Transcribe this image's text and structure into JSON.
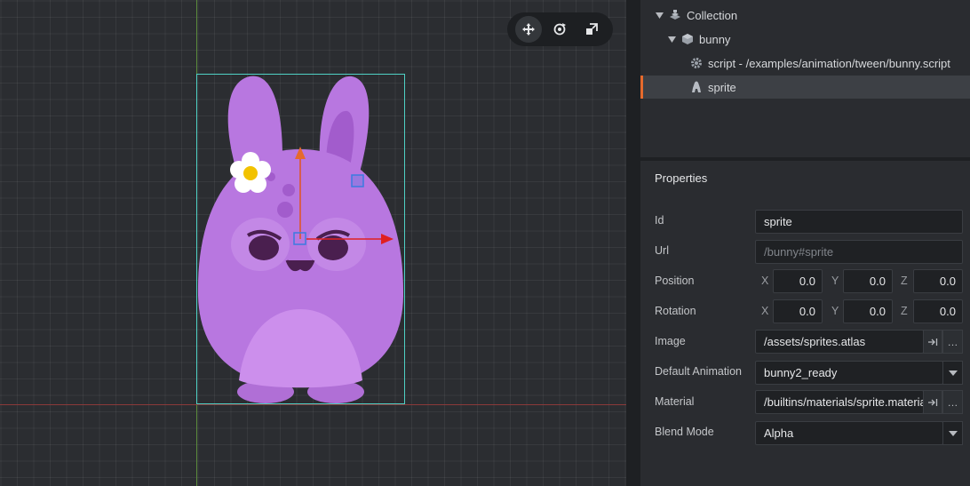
{
  "toolbar": {
    "move_icon": "move-icon",
    "rotate_icon": "rotate-icon",
    "scale_icon": "scale-icon"
  },
  "outline": {
    "items": [
      {
        "label": "Collection",
        "icon": "collection-icon"
      },
      {
        "label": "bunny",
        "icon": "gameobject-icon"
      },
      {
        "label": "script - /examples/animation/tween/bunny.script",
        "icon": "script-gear-icon"
      },
      {
        "label": "sprite",
        "icon": "sprite-icon"
      }
    ]
  },
  "properties": {
    "title": "Properties",
    "id": {
      "label": "Id",
      "value": "sprite"
    },
    "url": {
      "label": "Url",
      "placeholder": "/bunny#sprite"
    },
    "position": {
      "label": "Position",
      "x": "0.0",
      "y": "0.0",
      "z": "0.0"
    },
    "rotation": {
      "label": "Rotation",
      "x": "0.0",
      "y": "0.0",
      "z": "0.0"
    },
    "axis_x": "X",
    "axis_y": "Y",
    "axis_z": "Z",
    "image": {
      "label": "Image",
      "value": "/assets/sprites.atlas"
    },
    "default_animation": {
      "label": "Default Animation",
      "value": "bunny2_ready"
    },
    "material": {
      "label": "Material",
      "value": "/builtins/materials/sprite.material"
    },
    "blend_mode": {
      "label": "Blend Mode",
      "value": "Alpha"
    },
    "ellipsis": "…"
  },
  "colors": {
    "accent": "#e66a2c",
    "bounds": "#4fd1c5",
    "bunny": "#b877e0"
  }
}
